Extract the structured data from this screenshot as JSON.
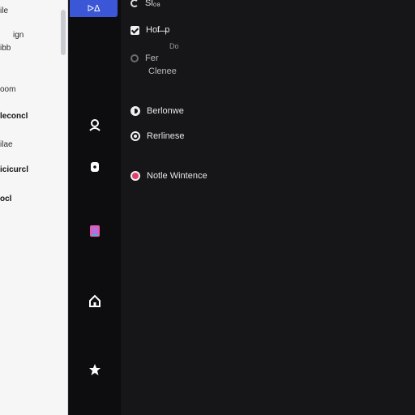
{
  "left_panel": {
    "items": [
      {
        "label": "ile",
        "bold": false
      },
      {
        "label": "ign",
        "bold": false
      },
      {
        "label": "ibb",
        "bold": false
      },
      {
        "label": "oom",
        "bold": false
      },
      {
        "label": "leconcl",
        "bold": true
      },
      {
        "label": "ilae",
        "bold": false
      },
      {
        "label": "icicurcl",
        "bold": true
      },
      {
        "label": "ocl",
        "bold": true
      }
    ]
  },
  "rail": {
    "top_button_label": "ᐅᐃ",
    "icons": [
      {
        "name": "user-icon",
        "color": "#ffffff"
      },
      {
        "name": "lock-icon",
        "color": "#ffffff"
      },
      {
        "name": "palette-icon",
        "color": "#e85aa8"
      },
      {
        "name": "home-icon",
        "color": "#ffffff"
      },
      {
        "name": "star-icon",
        "color": "#ffffff"
      }
    ]
  },
  "main": {
    "top_label": "Sl₀₈",
    "options": {
      "opt1_main": "Hof̶ ̶ ̶p",
      "opt1_sub": "Do",
      "opt2_main": "Fer",
      "opt2_sub": "Clenee",
      "opt3": "Berlonwe",
      "opt4": "Rerlinese",
      "opt5": "Notle Wintence"
    },
    "colors": {
      "accent": "#3b57d8",
      "pink": "#e0406b"
    }
  }
}
